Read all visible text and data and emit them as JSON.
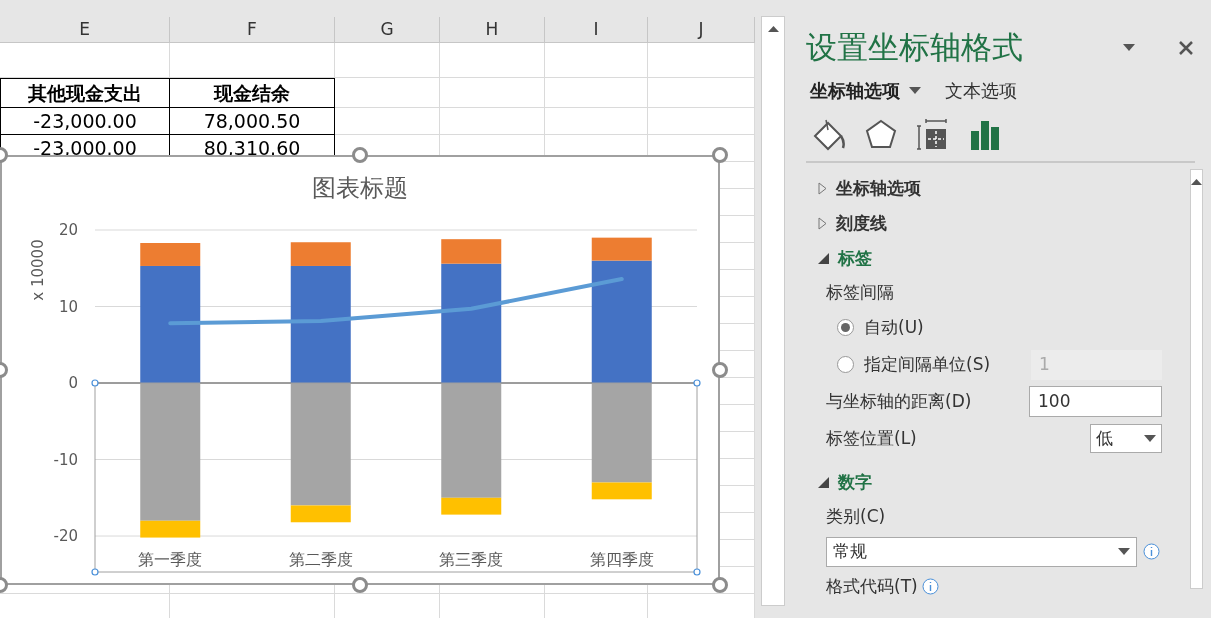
{
  "sheet": {
    "columns": [
      "E",
      "F",
      "G",
      "H",
      "I",
      "J"
    ],
    "rows": [
      {
        "kind": "blank"
      },
      {
        "kind": "header",
        "cells": [
          "其他现金支出",
          "现金结余"
        ]
      },
      {
        "kind": "data",
        "cells": [
          "-23,000.00",
          "78,000.50"
        ]
      },
      {
        "kind": "data",
        "cells": [
          "-23,000.00",
          "80,310.60"
        ]
      }
    ]
  },
  "chart": {
    "selected": true,
    "chart_data": {
      "type": "bar",
      "stacked": true,
      "grid": true,
      "title": "图表标题",
      "ylabel": "x 10000",
      "categories": [
        "第一季度",
        "第二季度",
        "第三季度",
        "第四季度"
      ],
      "ylim": [
        -24.7,
        20
      ],
      "yticks": [
        -20,
        -10,
        0,
        10,
        20
      ],
      "series": [
        {
          "type": "bar",
          "color": "#4472c4",
          "values": [
            15.3,
            15.3,
            15.6,
            16.0
          ]
        },
        {
          "type": "bar",
          "color": "#ed7d31",
          "values": [
            3.0,
            3.1,
            3.2,
            3.0
          ]
        },
        {
          "type": "bar",
          "color": "#a5a5a5",
          "values": [
            -18.0,
            -16.0,
            -15.0,
            -13.0
          ]
        },
        {
          "type": "bar",
          "color": "#ffc000",
          "values": [
            -2.2,
            -2.2,
            -2.2,
            -2.2
          ]
        },
        {
          "type": "line",
          "color": "#5b9bd5",
          "values": [
            7.8,
            8.1,
            9.7,
            13.6
          ]
        }
      ]
    }
  },
  "pane": {
    "title": "设置坐标轴格式",
    "tabs": [
      {
        "label": "坐标轴选项",
        "selected": true,
        "dropdown": true
      },
      {
        "label": "文本选项",
        "selected": false,
        "dropdown": false
      }
    ],
    "icon_tabs": [
      {
        "kind": "fill",
        "selected": false
      },
      {
        "kind": "effects",
        "selected": false
      },
      {
        "kind": "size",
        "selected": false
      },
      {
        "kind": "axis",
        "selected": true
      }
    ],
    "sections": [
      {
        "title": "坐标轴选项",
        "expanded": false
      },
      {
        "title": "刻度线",
        "expanded": false
      },
      {
        "title": "标签",
        "expanded": true,
        "controls": [
          {
            "kind": "caption",
            "label": "标签间隔"
          },
          {
            "kind": "radio",
            "label": "自动(U)",
            "selected": true
          },
          {
            "kind": "radio",
            "label": "指定间隔单位(S)",
            "selected": false,
            "value": "1",
            "disabled": true
          },
          {
            "kind": "input",
            "label": "与坐标轴的距离(D)",
            "value": "100"
          },
          {
            "kind": "select",
            "label": "标签位置(L)",
            "value": "低"
          }
        ]
      },
      {
        "title": "数字",
        "expanded": true,
        "controls": [
          {
            "kind": "caption",
            "label": "类别(C)"
          },
          {
            "kind": "wide-select",
            "value": "常规",
            "info": true
          },
          {
            "kind": "caption",
            "label": "格式代码(T)",
            "info": true
          }
        ]
      }
    ]
  }
}
